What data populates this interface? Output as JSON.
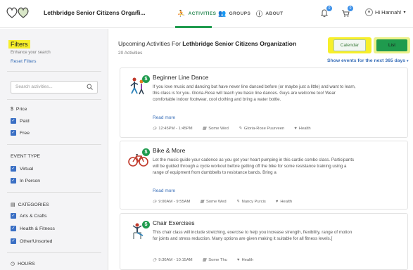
{
  "header": {
    "org_name": "Lethbridge Senior Citizens Organi...",
    "org_caret": "▾",
    "nav": {
      "activities": "ACTIVITIES",
      "groups": "GROUPS",
      "about": "ABOUT"
    },
    "notification_count": "0",
    "cart_count": "0",
    "user_greeting": "Hi Hannah!",
    "user_caret": "▾"
  },
  "sidebar": {
    "title": "Filters",
    "subtitle": "Enhance your search",
    "reset_label": "Reset Filters",
    "search_placeholder": "Search activities...",
    "price": {
      "heading": "Price",
      "options": [
        {
          "label": "Paid",
          "checked": true
        },
        {
          "label": "Free",
          "checked": true
        }
      ]
    },
    "event_type": {
      "heading": "EVENT TYPE",
      "options": [
        {
          "label": "Virtual",
          "checked": true
        },
        {
          "label": "In Person",
          "checked": true
        }
      ]
    },
    "categories": {
      "heading": "CATEGORIES",
      "options": [
        {
          "label": "Arts & Crafts",
          "checked": true
        },
        {
          "label": "Health & Fitness",
          "checked": true
        },
        {
          "label": "Other/Unsorted",
          "checked": true
        }
      ]
    },
    "hours": {
      "heading": "HOURS"
    }
  },
  "main": {
    "heading_prefix": "Upcoming Activities For",
    "heading_org": "Lethbridge Senior Citizens Organization",
    "count": "20 Activities",
    "calendar_label": "Calendar",
    "list_label": "List",
    "show_events": "Show events for the next 365 days",
    "read_more": "Read more",
    "activities": [
      {
        "title": "Beginner Line Dance",
        "description": "If you love music and dancing but have never line danced before (or maybe just a little) and want to learn, this class is for you. Gloria-Rose will teach you basic line dances. Guys are welcome too! Wear comfortable indoor footwear, cool clothing and bring a water bottle.",
        "price_badge": "$",
        "time": "12:45PM - 1:45PM",
        "day": "Some Wed",
        "instructor": "Gloria-Rose Puurveen",
        "category": "Health"
      },
      {
        "title": "Bike & More",
        "description": "Let the music guide your cadence as you get your heart pumping in this cardio combo class. Participants will be guided through a cycle workout before getting off the bike for some resistance training using a range of equipment from dumbbells to resistance bands. Bring a",
        "price_badge": "$",
        "time": "9:00AM - 9:55AM",
        "day": "Some Wed",
        "instructor": "Nancy Purcis",
        "category": "Health"
      },
      {
        "title": "Chair Exercises",
        "description": "This chair class will include stretching, exercise to help you increase strength, flexibility, range of motion for joints and stress reduction. Many options are given making it suitable for all fitness levels.[",
        "price_badge": "$",
        "time": "9:30AM - 10:15AM",
        "day": "Some Thu",
        "category": "Health"
      }
    ]
  },
  "colors": {
    "brand_green": "#1f9b4e",
    "link_blue": "#3a6fb8",
    "highlight_yellow": "#f7ef2a",
    "checkbox_blue": "#3a6fc4"
  }
}
